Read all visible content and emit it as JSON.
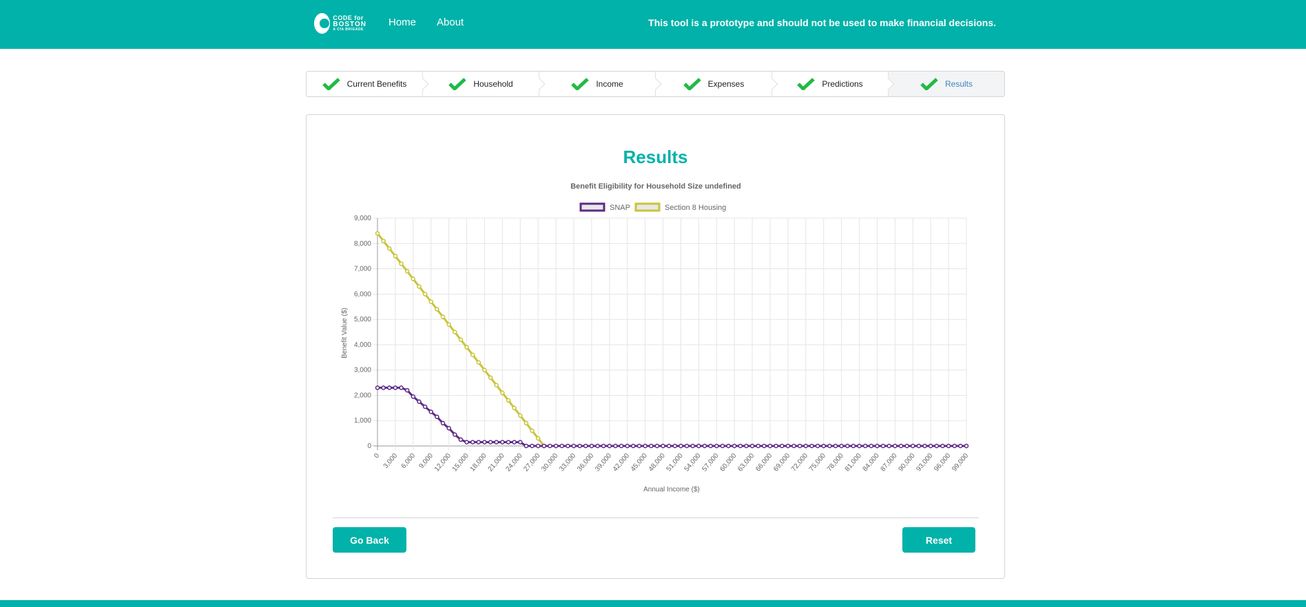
{
  "header": {
    "logo": {
      "line1": "CODE for",
      "line2": "BOSTON",
      "line3": "A CfA BRIGADE"
    },
    "nav": [
      {
        "label": "Home"
      },
      {
        "label": "About"
      }
    ],
    "disclaimer": "This tool is a prototype and should not be used to make financial decisions."
  },
  "steps": [
    {
      "label": "Current Benefits",
      "icon": "check-icon"
    },
    {
      "label": "Household",
      "icon": "check-icon"
    },
    {
      "label": "Income",
      "icon": "check-icon"
    },
    {
      "label": "Expenses",
      "icon": "check-icon"
    },
    {
      "label": "Predictions",
      "icon": "check-icon"
    },
    {
      "label": "Results",
      "icon": "check-icon",
      "active": true
    }
  ],
  "colors": {
    "primary": "#00b2a9",
    "check": "#21ba45",
    "snap": "#5e2a84",
    "section8": "#c9c43a"
  },
  "results": {
    "title": "Results",
    "back_label": "Go Back",
    "reset_label": "Reset"
  },
  "chart_data": {
    "type": "line",
    "title": "Benefit Eligibility for Household Size undefined",
    "xlabel": "Annual Income ($)",
    "ylabel": "Benefit Value ($)",
    "ylim": [
      0,
      9000
    ],
    "yticks": [
      "0",
      "1,000",
      "2,000",
      "3,000",
      "4,000",
      "5,000",
      "6,000",
      "7,000",
      "8,000",
      "9,000"
    ],
    "xticks": [
      "0",
      "3,000",
      "6,000",
      "9,000",
      "12,000",
      "15,000",
      "18,000",
      "21,000",
      "24,000",
      "27,000",
      "30,000",
      "33,000",
      "36,000",
      "39,000",
      "42,000",
      "45,000",
      "48,000",
      "51,000",
      "54,000",
      "57,000",
      "60,000",
      "63,000",
      "66,000",
      "69,000",
      "72,000",
      "75,000",
      "78,000",
      "81,000",
      "84,000",
      "87,000",
      "90,000",
      "93,000",
      "96,000",
      "99,000"
    ],
    "grid": true,
    "legend_position": "top",
    "series": [
      {
        "name": "SNAP",
        "color": "#5e2a84",
        "points": [
          [
            0,
            2300
          ],
          [
            1000,
            2300
          ],
          [
            2000,
            2300
          ],
          [
            3000,
            2300
          ],
          [
            4000,
            2300
          ],
          [
            5000,
            2200
          ],
          [
            6000,
            1950
          ],
          [
            7000,
            1750
          ],
          [
            8000,
            1550
          ],
          [
            9000,
            1350
          ],
          [
            10000,
            1150
          ],
          [
            11000,
            900
          ],
          [
            12000,
            700
          ],
          [
            13000,
            450
          ],
          [
            14000,
            250
          ],
          [
            15000,
            150
          ],
          [
            16000,
            150
          ],
          [
            17000,
            150
          ],
          [
            18000,
            150
          ],
          [
            19000,
            150
          ],
          [
            20000,
            150
          ],
          [
            21000,
            150
          ],
          [
            22000,
            150
          ],
          [
            23000,
            150
          ],
          [
            24000,
            150
          ],
          [
            25000,
            0
          ],
          [
            26000,
            0
          ],
          [
            27000,
            0
          ],
          [
            28000,
            0
          ],
          [
            29000,
            0
          ],
          [
            30000,
            0
          ],
          [
            31000,
            0
          ],
          [
            32000,
            0
          ],
          [
            33000,
            0
          ],
          [
            34000,
            0
          ],
          [
            35000,
            0
          ],
          [
            36000,
            0
          ],
          [
            37000,
            0
          ],
          [
            38000,
            0
          ],
          [
            39000,
            0
          ],
          [
            40000,
            0
          ],
          [
            41000,
            0
          ],
          [
            42000,
            0
          ],
          [
            43000,
            0
          ],
          [
            44000,
            0
          ],
          [
            45000,
            0
          ],
          [
            46000,
            0
          ],
          [
            47000,
            0
          ],
          [
            48000,
            0
          ],
          [
            49000,
            0
          ],
          [
            50000,
            0
          ],
          [
            51000,
            0
          ],
          [
            52000,
            0
          ],
          [
            53000,
            0
          ],
          [
            54000,
            0
          ],
          [
            55000,
            0
          ],
          [
            56000,
            0
          ],
          [
            57000,
            0
          ],
          [
            58000,
            0
          ],
          [
            59000,
            0
          ],
          [
            60000,
            0
          ],
          [
            61000,
            0
          ],
          [
            62000,
            0
          ],
          [
            63000,
            0
          ],
          [
            64000,
            0
          ],
          [
            65000,
            0
          ],
          [
            66000,
            0
          ],
          [
            67000,
            0
          ],
          [
            68000,
            0
          ],
          [
            69000,
            0
          ],
          [
            70000,
            0
          ],
          [
            71000,
            0
          ],
          [
            72000,
            0
          ],
          [
            73000,
            0
          ],
          [
            74000,
            0
          ],
          [
            75000,
            0
          ],
          [
            76000,
            0
          ],
          [
            77000,
            0
          ],
          [
            78000,
            0
          ],
          [
            79000,
            0
          ],
          [
            80000,
            0
          ],
          [
            81000,
            0
          ],
          [
            82000,
            0
          ],
          [
            83000,
            0
          ],
          [
            84000,
            0
          ],
          [
            85000,
            0
          ],
          [
            86000,
            0
          ],
          [
            87000,
            0
          ],
          [
            88000,
            0
          ],
          [
            89000,
            0
          ],
          [
            90000,
            0
          ],
          [
            91000,
            0
          ],
          [
            92000,
            0
          ],
          [
            93000,
            0
          ],
          [
            94000,
            0
          ],
          [
            95000,
            0
          ],
          [
            96000,
            0
          ],
          [
            97000,
            0
          ],
          [
            98000,
            0
          ],
          [
            99000,
            0
          ]
        ]
      },
      {
        "name": "Section 8 Housing",
        "color": "#c9c43a",
        "points": [
          [
            0,
            8400
          ],
          [
            1000,
            8100
          ],
          [
            2000,
            7800
          ],
          [
            3000,
            7500
          ],
          [
            4000,
            7200
          ],
          [
            5000,
            6900
          ],
          [
            6000,
            6600
          ],
          [
            7000,
            6300
          ],
          [
            8000,
            6000
          ],
          [
            9000,
            5700
          ],
          [
            10000,
            5400
          ],
          [
            11000,
            5100
          ],
          [
            12000,
            4800
          ],
          [
            13000,
            4500
          ],
          [
            14000,
            4200
          ],
          [
            15000,
            3900
          ],
          [
            16000,
            3600
          ],
          [
            17000,
            3300
          ],
          [
            18000,
            3000
          ],
          [
            19000,
            2700
          ],
          [
            20000,
            2400
          ],
          [
            21000,
            2100
          ],
          [
            22000,
            1800
          ],
          [
            23000,
            1500
          ],
          [
            24000,
            1200
          ],
          [
            25000,
            900
          ],
          [
            26000,
            600
          ],
          [
            27000,
            300
          ],
          [
            28000,
            0
          ]
        ]
      }
    ]
  }
}
